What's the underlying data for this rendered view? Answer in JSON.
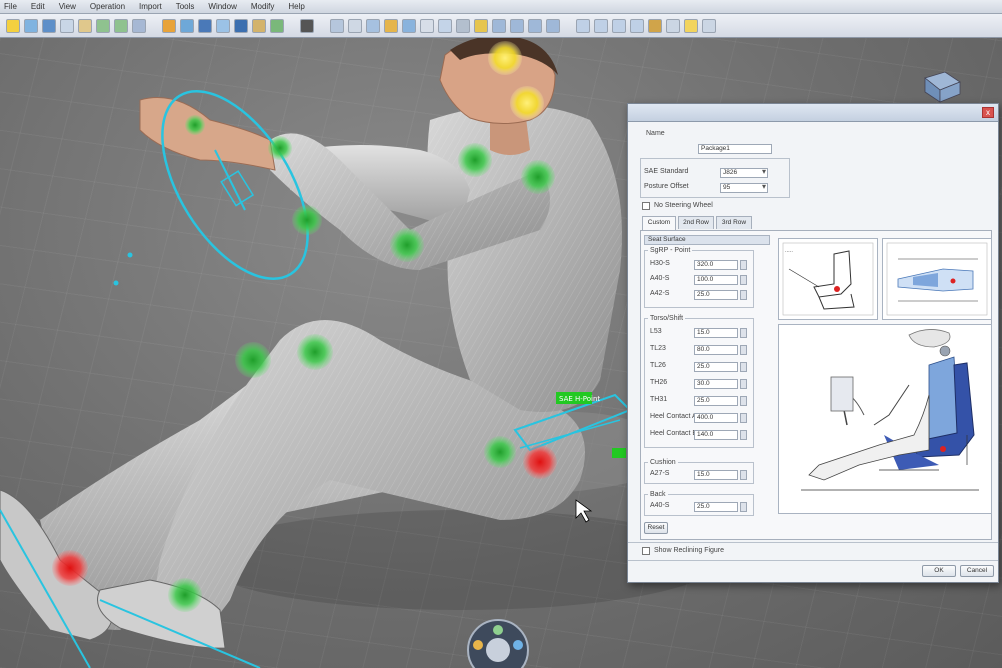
{
  "app": {
    "menu": [
      "File",
      "Edit",
      "View",
      "Operation",
      "Import",
      "Tools",
      "Window",
      "Modify",
      "Help"
    ]
  },
  "dialog": {
    "close_label": "x",
    "name_label": "Name",
    "name_value": "Package1",
    "standard_label": "SAE Standard",
    "standard_value": "J826",
    "posture_label": "Posture Offset",
    "posture_value": "95",
    "steering_label": "No Steering Wheel",
    "tabs": [
      "Custom",
      "2nd Row",
      "3rd Row"
    ],
    "section": "Seat Surface",
    "group1_title": "SgRP - Point",
    "group2_title": "Torso/Shift",
    "group3_title": "Cushion",
    "group4_title": "Back",
    "rows1": [
      {
        "label": "H30-S",
        "value": "320.0"
      },
      {
        "label": "A40-S",
        "value": "100.0"
      },
      {
        "label": "A42-S",
        "value": "25.0"
      }
    ],
    "rows2": [
      {
        "label": "L53",
        "value": "15.0"
      },
      {
        "label": "TL23",
        "value": "80.0"
      },
      {
        "label": "TL26",
        "value": "25.0"
      },
      {
        "label": "TH26",
        "value": "30.0"
      },
      {
        "label": "TH31",
        "value": "25.0"
      },
      {
        "label": "Heel Contact A",
        "value": "400.0"
      },
      {
        "label": "Heel Contact B",
        "value": "140.0"
      }
    ],
    "rows3": [
      {
        "label": "A27-S",
        "value": "15.0"
      }
    ],
    "rows4": [
      {
        "label": "A40-S",
        "value": "25.0"
      }
    ],
    "reset_label": "Reset",
    "footer_check_label": "Show Reclining Figure",
    "ok_label": "OK",
    "cancel_label": "Cancel"
  },
  "viewport": {
    "manikin_tag": "SAE H-Point"
  }
}
